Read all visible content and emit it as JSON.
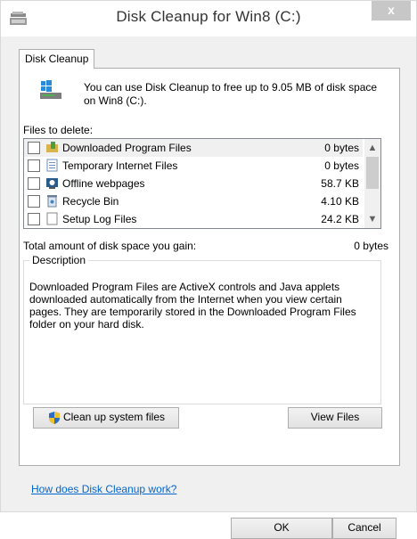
{
  "window": {
    "title": "Disk Cleanup for Win8 (C:)",
    "close_glyph": "x",
    "icon": "disk-cleanup-icon"
  },
  "tab": {
    "label": "Disk Cleanup"
  },
  "intro": {
    "text": "You can use Disk Cleanup to free up to 9.05 MB of disk space on Win8 (C:).",
    "icon": "drive-icon"
  },
  "files": {
    "label": "Files to delete:",
    "items": [
      {
        "name": "Downloaded Program Files",
        "size": "0 bytes",
        "checked": false,
        "icon": "folder-icon"
      },
      {
        "name": "Temporary Internet Files",
        "size": "0 bytes",
        "checked": false,
        "icon": "internet-files-icon"
      },
      {
        "name": "Offline webpages",
        "size": "58.7 KB",
        "checked": false,
        "icon": "offline-webpages-icon"
      },
      {
        "name": "Recycle Bin",
        "size": "4.10 KB",
        "checked": false,
        "icon": "recycle-bin-icon"
      },
      {
        "name": "Setup Log Files",
        "size": "24.2 KB",
        "checked": false,
        "icon": "document-icon"
      }
    ]
  },
  "total": {
    "label": "Total amount of disk space you gain:",
    "value": "0 bytes"
  },
  "description": {
    "title": "Description",
    "text": "Downloaded Program Files are ActiveX controls and Java applets downloaded automatically from the Internet when you view certain pages. They are temporarily stored in the Downloaded Program Files folder on your hard disk."
  },
  "buttons": {
    "cleanup_system": "Clean up system files",
    "view_files": "View Files",
    "ok": "OK",
    "cancel": "Cancel"
  },
  "help_link": "How does Disk Cleanup work?",
  "colors": {
    "link": "#0066cc",
    "selected_row": "#f0f0f0",
    "dialog_bg": "#f0f0f0"
  }
}
